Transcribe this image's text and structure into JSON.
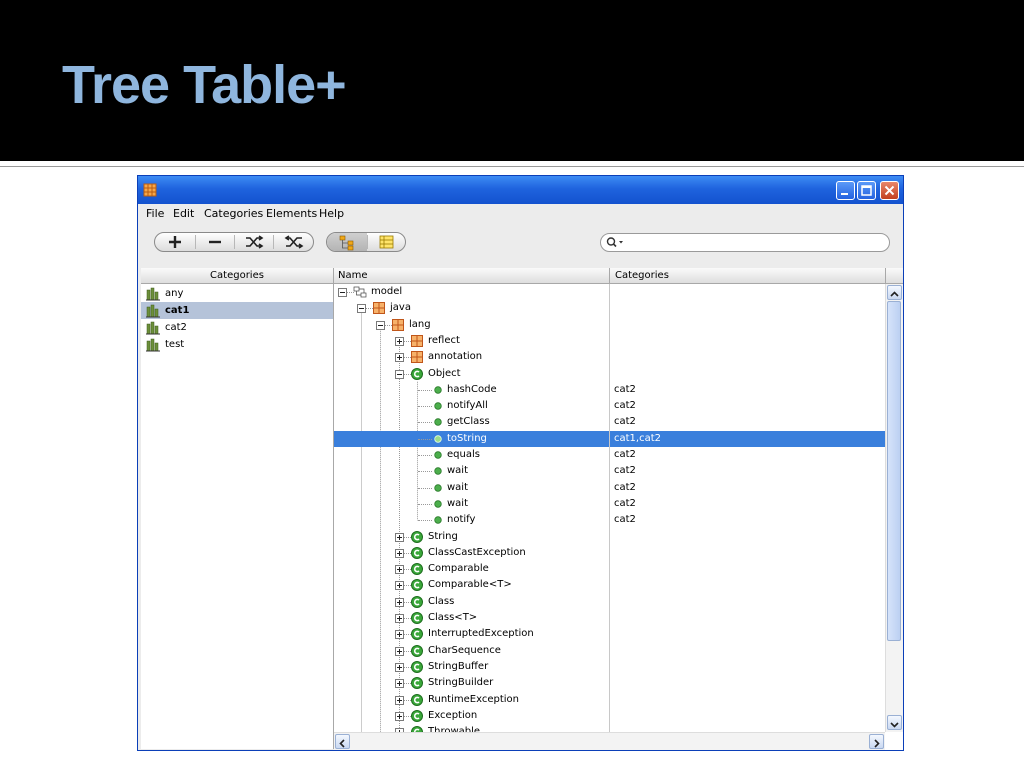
{
  "slide": {
    "title": "Tree Table+"
  },
  "window": {
    "menu": [
      "File",
      "Edit",
      "Categories",
      "Elements",
      "Help"
    ]
  },
  "categories_pane": {
    "header": "Categories",
    "items": [
      {
        "label": "any",
        "selected": false
      },
      {
        "label": "cat1",
        "selected": true
      },
      {
        "label": "cat2",
        "selected": false
      },
      {
        "label": "test",
        "selected": false
      }
    ]
  },
  "tree_table": {
    "columns": [
      "Name",
      "Categories"
    ],
    "rows": [
      {
        "name": "model",
        "categories": "",
        "level": 0,
        "icon": "model-icon",
        "expander": "minus"
      },
      {
        "name": "java",
        "categories": "",
        "level": 1,
        "icon": "package-icon",
        "expander": "minus"
      },
      {
        "name": "lang",
        "categories": "",
        "level": 2,
        "icon": "package-icon",
        "expander": "minus"
      },
      {
        "name": "reflect",
        "categories": "",
        "level": 3,
        "icon": "package-icon",
        "expander": "plus"
      },
      {
        "name": "annotation",
        "categories": "",
        "level": 3,
        "icon": "package-icon",
        "expander": "plus"
      },
      {
        "name": "Object",
        "categories": "",
        "level": 3,
        "icon": "class-icon",
        "expander": "minus"
      },
      {
        "name": "hashCode",
        "categories": "cat2",
        "level": 4,
        "icon": "method-icon",
        "expander": "none"
      },
      {
        "name": "notifyAll",
        "categories": "cat2",
        "level": 4,
        "icon": "method-icon",
        "expander": "none"
      },
      {
        "name": "getClass",
        "categories": "cat2",
        "level": 4,
        "icon": "method-icon",
        "expander": "none"
      },
      {
        "name": "toString",
        "categories": "cat1,cat2",
        "level": 4,
        "icon": "method-icon",
        "expander": "none",
        "selected": true
      },
      {
        "name": "equals",
        "categories": "cat2",
        "level": 4,
        "icon": "method-icon",
        "expander": "none"
      },
      {
        "name": "wait",
        "categories": "cat2",
        "level": 4,
        "icon": "method-icon",
        "expander": "none"
      },
      {
        "name": "wait",
        "categories": "cat2",
        "level": 4,
        "icon": "method-icon",
        "expander": "none"
      },
      {
        "name": "wait",
        "categories": "cat2",
        "level": 4,
        "icon": "method-icon",
        "expander": "none"
      },
      {
        "name": "notify",
        "categories": "cat2",
        "level": 4,
        "icon": "method-icon",
        "expander": "none"
      },
      {
        "name": "String",
        "categories": "",
        "level": 3,
        "icon": "class-icon",
        "expander": "plus"
      },
      {
        "name": "ClassCastException",
        "categories": "",
        "level": 3,
        "icon": "class-icon",
        "expander": "plus"
      },
      {
        "name": "Comparable",
        "categories": "",
        "level": 3,
        "icon": "class-icon",
        "expander": "plus"
      },
      {
        "name": "Comparable<T>",
        "categories": "",
        "level": 3,
        "icon": "class-icon",
        "expander": "plus"
      },
      {
        "name": "Class",
        "categories": "",
        "level": 3,
        "icon": "class-icon",
        "expander": "plus"
      },
      {
        "name": "Class<T>",
        "categories": "",
        "level": 3,
        "icon": "class-icon",
        "expander": "plus"
      },
      {
        "name": "InterruptedException",
        "categories": "",
        "level": 3,
        "icon": "class-icon",
        "expander": "plus"
      },
      {
        "name": "CharSequence",
        "categories": "",
        "level": 3,
        "icon": "class-icon",
        "expander": "plus"
      },
      {
        "name": "StringBuffer",
        "categories": "",
        "level": 3,
        "icon": "class-icon",
        "expander": "plus"
      },
      {
        "name": "StringBuilder",
        "categories": "",
        "level": 3,
        "icon": "class-icon",
        "expander": "plus"
      },
      {
        "name": "RuntimeException",
        "categories": "",
        "level": 3,
        "icon": "class-icon",
        "expander": "plus"
      },
      {
        "name": "Exception",
        "categories": "",
        "level": 3,
        "icon": "class-icon",
        "expander": "plus"
      },
      {
        "name": "Throwable",
        "categories": "",
        "level": 3,
        "icon": "class-icon",
        "expander": "plus"
      }
    ]
  },
  "colors": {
    "slide_bg": "#000000",
    "title": "#8fb6de",
    "titlebar": "#1f63de",
    "selection": "#3a7fdc",
    "category_selection": "#b5c3d9",
    "class_icon": "#2ea03a",
    "method_icon": "#4cae4c",
    "package_icon": "#d9701e"
  }
}
